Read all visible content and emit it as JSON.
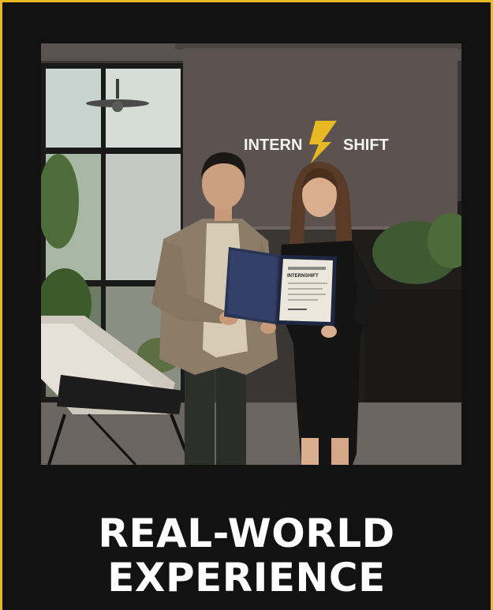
{
  "photo": {
    "screen_brand_left": "INTERN",
    "screen_brand_right": "SHIFT",
    "certificate_title": "INTERNSHIFT"
  },
  "headline": {
    "line1": "REAL-WORLD",
    "line2": "EXPERIENCE"
  },
  "colors": {
    "frame_border": "#e8b923",
    "background": "#121212",
    "headline_text": "#ffffff",
    "logo_accent": "#e8b923"
  }
}
